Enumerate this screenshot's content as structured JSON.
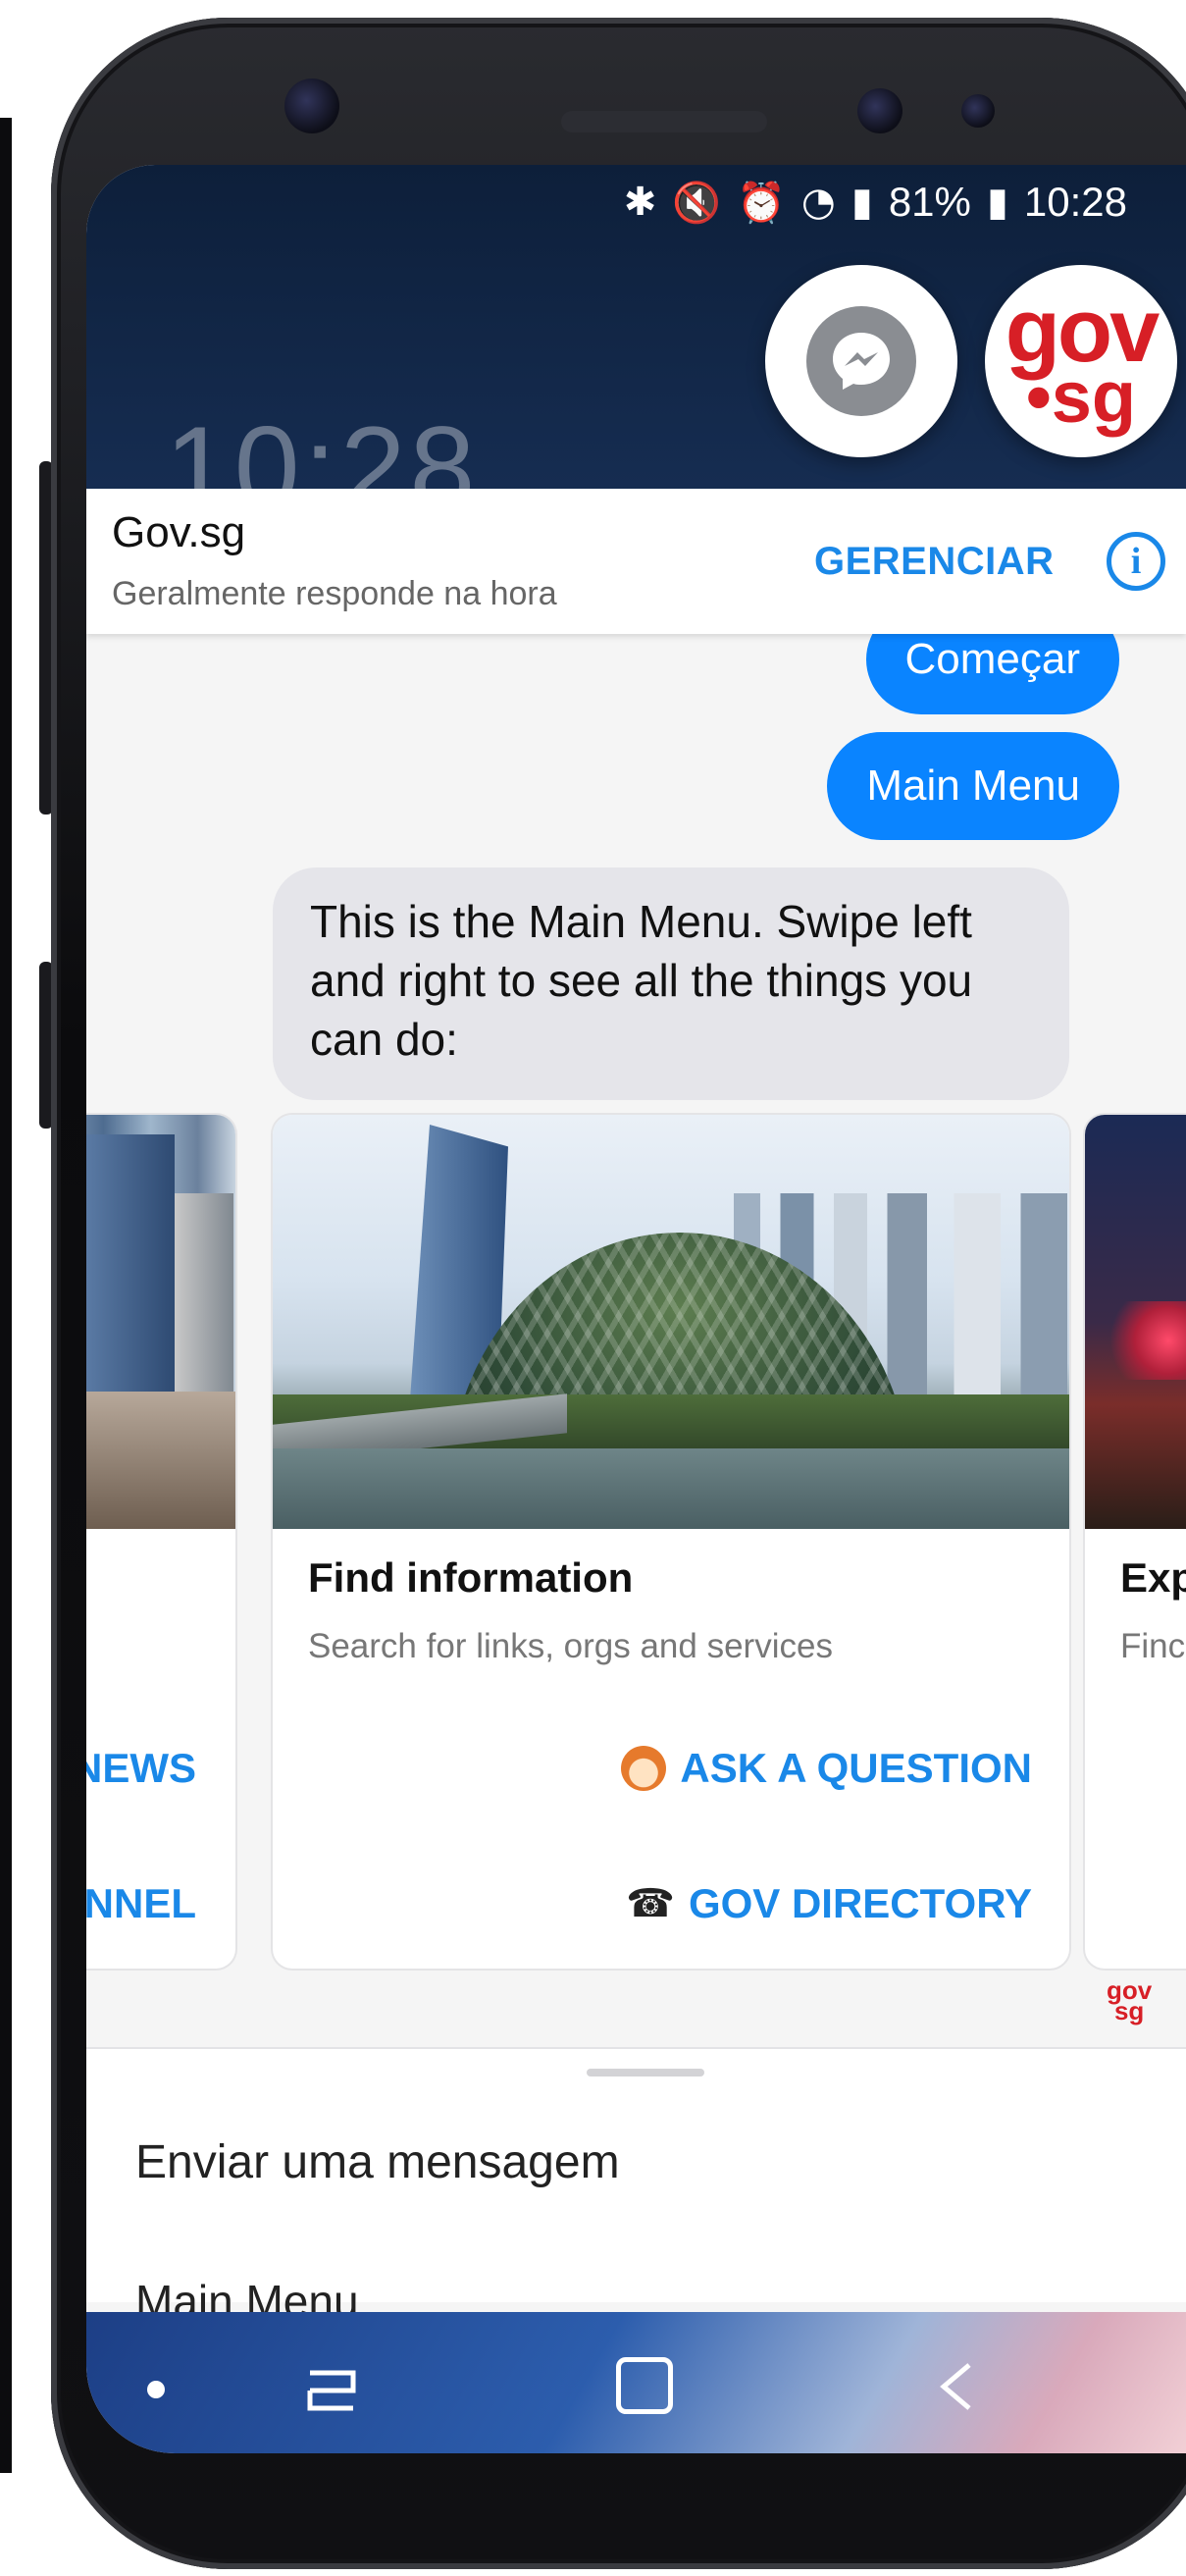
{
  "status_bar": {
    "battery": "81%",
    "time": "10:28",
    "background_clock": "10:28"
  },
  "floating_heads": {
    "messenger": "messenger-icon",
    "gov_logo_line1": "gov",
    "gov_logo_line2": "•sg"
  },
  "chat_header": {
    "title": "Gov.sg",
    "subtitle": "Geralmente responde na hora",
    "manage_label": "GERENCIAR",
    "info_icon": "i"
  },
  "messages": {
    "outgoing": [
      "Começar",
      "Main Menu"
    ],
    "incoming": "This is the Main Menu. Swipe left and right to see all the things you can do:"
  },
  "carousel": {
    "left_card": {
      "action_1": "NEWS",
      "action_2": "ANNEL"
    },
    "main_card": {
      "title": "Find information",
      "subtitle": "Search for links, orgs and services",
      "action_1": "ASK A QUESTION",
      "action_2": "GOV DIRECTORY"
    },
    "right_card": {
      "title": "Exp",
      "subtitle": "Finc"
    }
  },
  "small_logo": {
    "line1": "gov",
    "line2": "sg"
  },
  "composer": {
    "placeholder": "Enviar uma mensagem",
    "suggestion": "Main Menu"
  },
  "colors": {
    "accent": "#0a84ff",
    "link": "#1a88e8",
    "gov_red": "#d71f26"
  }
}
